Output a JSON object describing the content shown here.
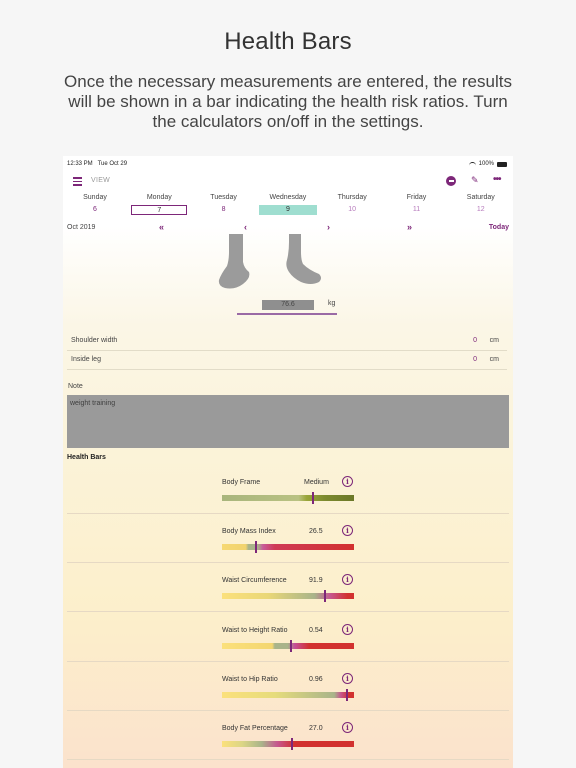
{
  "promo": {
    "title": "Health Bars",
    "subtitle": "Once the necessary measurements are entered, the results will be shown in a bar indicating the health risk ratios. Turn the calculators on/off in the settings."
  },
  "status": {
    "time": "12:33 PM",
    "date": "Tue Oct 29",
    "battery": "100%"
  },
  "toolbar": {
    "view_label": "VIEW"
  },
  "week": [
    {
      "name": "Sunday",
      "num": "6",
      "style": "purple"
    },
    {
      "name": "Monday",
      "num": "7",
      "style": "selected"
    },
    {
      "name": "Tuesday",
      "num": "8",
      "style": "purple"
    },
    {
      "name": "Wednesday",
      "num": "9",
      "style": "today"
    },
    {
      "name": "Thursday",
      "num": "10",
      "style": "light"
    },
    {
      "name": "Friday",
      "num": "11",
      "style": "light"
    },
    {
      "name": "Saturday",
      "num": "12",
      "style": "light"
    }
  ],
  "nav": {
    "month": "Oct 2019",
    "today": "Today"
  },
  "weight": {
    "value": "76.6",
    "unit": "kg"
  },
  "measurements": [
    {
      "label": "Shoulder width",
      "value": "0",
      "unit": "cm"
    },
    {
      "label": "Inside leg",
      "value": "0",
      "unit": "cm"
    }
  ],
  "note": {
    "label": "Note",
    "text": "weight training"
  },
  "health_bars": {
    "heading": "Health Bars",
    "items": [
      {
        "label": "Body Frame",
        "value": "Medium",
        "marker": 0.69,
        "stops": [
          "#a8b57c 0%",
          "#b9c282 58%",
          "#9aa63a 64%",
          "#7c8a2e 78%",
          "#6b7828 100%"
        ]
      },
      {
        "label": "Body Mass Index",
        "value": "26.5",
        "marker": 0.26,
        "stops": [
          "#f6d873 0%",
          "#f1d36e 18%",
          "#a9b48a 20%",
          "#a9b48a 27%",
          "#c95b9a 31%",
          "#cf3a55 40%",
          "#d2312f 100%"
        ]
      },
      {
        "label": "Waist Circumference",
        "value": "91.9",
        "marker": 0.78,
        "stops": [
          "#fbe07c 0%",
          "#e9d777 35%",
          "#a9b48a 70%",
          "#c6578f 82%",
          "#d2312f 95%",
          "#d2312f 100%"
        ]
      },
      {
        "label": "Waist to Height Ratio",
        "value": "0.54",
        "marker": 0.52,
        "stops": [
          "#fbe07c 0%",
          "#f3d670 38%",
          "#a9b48a 40%",
          "#a9b48a 50%",
          "#c4509a 55%",
          "#d2312f 66%",
          "#d2312f 100%"
        ]
      },
      {
        "label": "Waist to Hip Ratio",
        "value": "0.96",
        "marker": 0.95,
        "stops": [
          "#fbe07c 0%",
          "#e6dc7c 40%",
          "#a9b48a 85%",
          "#c6578f 90%",
          "#d2312f 96%",
          "#d2312f 100%"
        ]
      },
      {
        "label": "Body Fat Percentage",
        "value": "27.0",
        "marker": 0.53,
        "stops": [
          "#fbe07c 0%",
          "#dcd686 15%",
          "#a9b48a 30%",
          "#c6578f 42%",
          "#d2312f 55%",
          "#d2312f 100%"
        ]
      }
    ]
  }
}
